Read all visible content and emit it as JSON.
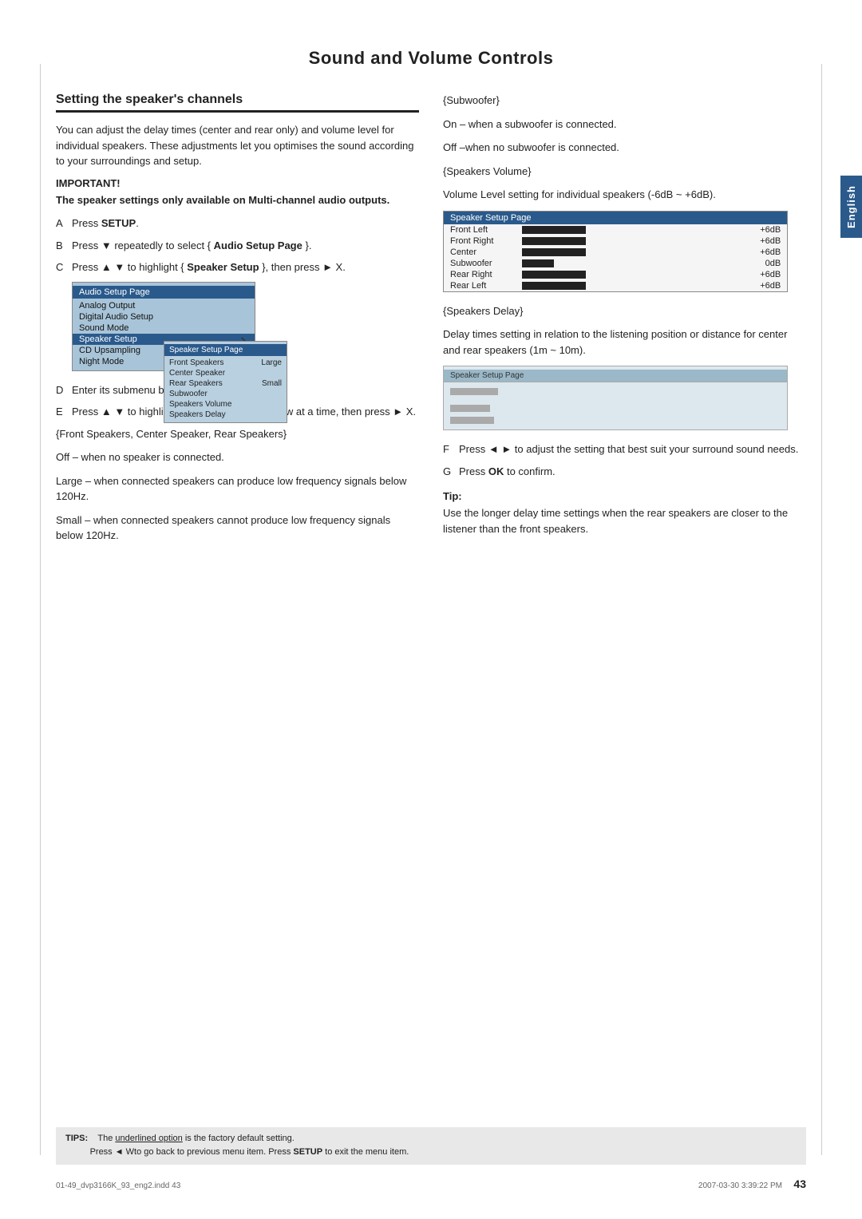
{
  "page": {
    "title": "Sound and Volume Controls",
    "number": "43",
    "footer_left": "01-49_dvp3166K_93_eng2.indd   43",
    "footer_right": "2007-03-30   3:39:22 PM"
  },
  "english_tab": "English",
  "section": {
    "heading": "Setting the speaker's channels",
    "intro": "You can adjust the delay times (center and rear only) and volume level for individual speakers. These adjustments let you optimises the sound according to your surroundings and setup.",
    "important_label": "IMPORTANT!",
    "important_body": "The speaker settings only available on Multi-channel audio outputs.",
    "steps": [
      {
        "letter": "A",
        "text": "Press SETUP.",
        "bold_words": [
          "SETUP"
        ]
      },
      {
        "letter": "B",
        "text": "Press  X repeatedly to select { Audio Setup Page }.",
        "bold_words": [
          "Audio",
          "Setup Page"
        ]
      },
      {
        "letter": "C",
        "text": "Press  S  T to highlight { Speaker Setup }, then press   X.",
        "bold_words": [
          "Speaker",
          "Setup"
        ]
      },
      {
        "letter": "D",
        "text": "Enter its submenu by pressing  X."
      },
      {
        "letter": "E",
        "text": "Press  S  T to highlight one of the options below at a time, then press  X."
      }
    ],
    "front_speakers_heading": "{Front Speakers, Center Speaker, Rear Speakers}",
    "front_speakers_body": [
      "Off –  when no speaker is connected.",
      "Large – when connected speakers can produce low frequency signals below 120Hz.",
      "Small – when connected speakers cannot produce low frequency signals below 120Hz."
    ]
  },
  "audio_setup_menu": {
    "title": "Audio Setup Page",
    "items": [
      "Analog Output",
      "Digital Audio Setup",
      "Sound Mode",
      "Speaker Setup",
      "CD Upsampling",
      "Night Mode"
    ],
    "highlighted": "Speaker Setup"
  },
  "speaker_submenu": {
    "title": "Speaker Setup Page",
    "items": [
      {
        "label": "Front Speakers",
        "value": "Large"
      },
      {
        "label": "Center Speaker",
        "value": ""
      },
      {
        "label": "Rear Speakers",
        "value": "Small"
      },
      {
        "label": "Subwoofer",
        "value": ""
      },
      {
        "label": "Speakers Volume",
        "value": ""
      },
      {
        "label": "Speakers Delay",
        "value": ""
      }
    ]
  },
  "right_col": {
    "subwoofer_heading": "{Subwoofer}",
    "subwoofer_body": [
      "On – when a subwoofer is connected.",
      "Off –when no subwoofer is connected."
    ],
    "speakers_volume_heading": "{Speakers Volume}",
    "speakers_volume_body": "Volume Level setting for individual speakers (-6dB ~ +6dB).",
    "speaker_setup_table": {
      "title": "Speaker Setup Page",
      "rows": [
        {
          "label": "Front Left",
          "value": "+6dB"
        },
        {
          "label": "Front Right",
          "value": "+6dB"
        },
        {
          "label": "Center",
          "value": "+6dB"
        },
        {
          "label": "Subwoofer",
          "value": "0dB"
        },
        {
          "label": "Rear Right",
          "value": "+6dB"
        },
        {
          "label": "Rear Left",
          "value": "+6dB"
        }
      ]
    },
    "speakers_delay_heading": "{Speakers Delay}",
    "speakers_delay_body": "Delay times setting in relation to the listening position or distance for center and rear speakers (1m ~ 10m).",
    "step_f": "Press  W X to adjust the setting that best suit your surround sound needs.",
    "step_g": "Press OK to confirm.",
    "step_f_letter": "F",
    "step_g_letter": "G",
    "ok_bold": "OK",
    "tip_heading": "Tip:",
    "tip_body": "Use the longer delay time settings when the rear speakers are closer to the listener than the front speakers."
  },
  "tips_bar": {
    "label": "TIPS:",
    "line1": "The underlined option is the factory default setting.",
    "line2": "Press  Wto go back to previous menu item. Press SETUP to exit the menu item."
  }
}
